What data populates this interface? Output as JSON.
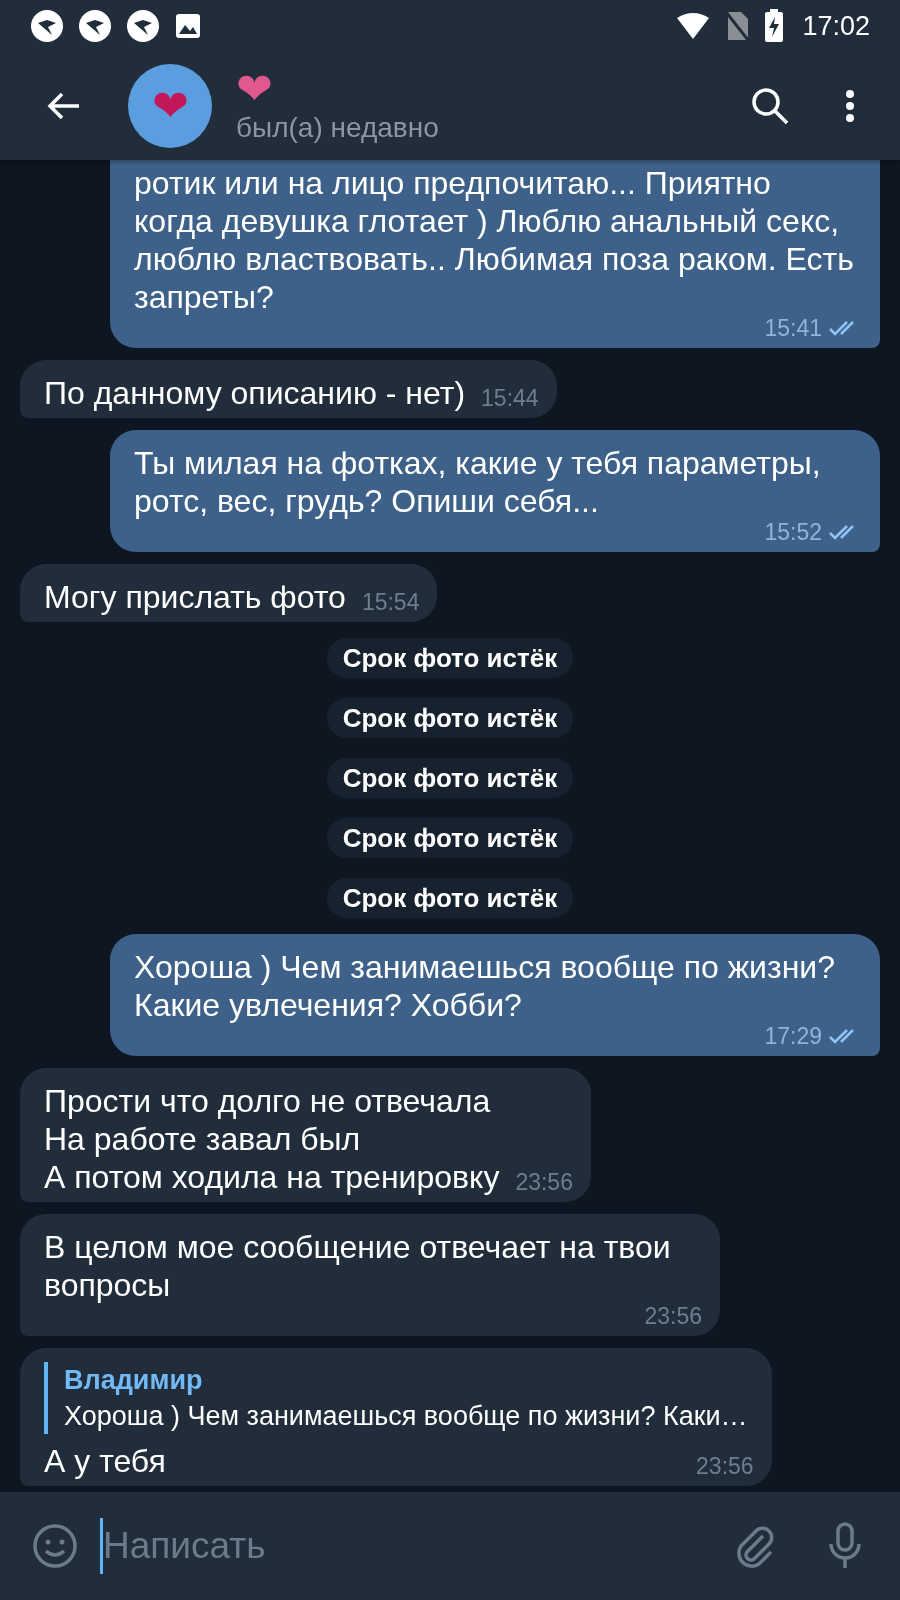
{
  "status_bar": {
    "time": "17:02"
  },
  "header": {
    "avatar": "❤",
    "title": "❤",
    "status": "был(а) недавно"
  },
  "messages": [
    {
      "kind": "text",
      "outgoing": true,
      "text": "ротик или на лицо предпочитаю... Приятно когда девушка глотает ) Люблю анальный секс, люблю властвовать.. Любимая поза раком. Есть запреты?",
      "time": "15:41",
      "read": true
    },
    {
      "kind": "text",
      "outgoing": false,
      "text": "По данному описанию - нет)",
      "time": "15:44"
    },
    {
      "kind": "text",
      "outgoing": true,
      "text": "Ты милая на фотках, какие у тебя параметры, ротс, вес, грудь? Опиши себя...",
      "time": "15:52",
      "read": true
    },
    {
      "kind": "text",
      "outgoing": false,
      "text": "Могу прислать фото",
      "time": "15:54"
    },
    {
      "kind": "service",
      "text": "Срок фото истёк"
    },
    {
      "kind": "service",
      "text": "Срок фото истёк"
    },
    {
      "kind": "service",
      "text": "Срок фото истёк"
    },
    {
      "kind": "service",
      "text": "Срок фото истёк"
    },
    {
      "kind": "service",
      "text": "Срок фото истёк"
    },
    {
      "kind": "text",
      "outgoing": true,
      "text": "Хороша ) Чем занимаешься вообще по жизни? Какие увлечения? Хобби?",
      "time": "17:29",
      "read": true
    },
    {
      "kind": "text",
      "outgoing": false,
      "text": "Прости что долго не отвечала\nНа работе завал был\nА потом ходила на тренировку",
      "time": "23:56"
    },
    {
      "kind": "text",
      "outgoing": false,
      "text": "В целом мое сообщение отвечает на твои вопросы",
      "time": "23:56"
    },
    {
      "kind": "reply",
      "outgoing": false,
      "reply_author": "Владимир",
      "reply_text": "Хороша ) Чем занимаешься вообще по жизни? Каки…",
      "text": "А у тебя",
      "time": "23:56"
    }
  ],
  "composer": {
    "placeholder": "Написать"
  }
}
